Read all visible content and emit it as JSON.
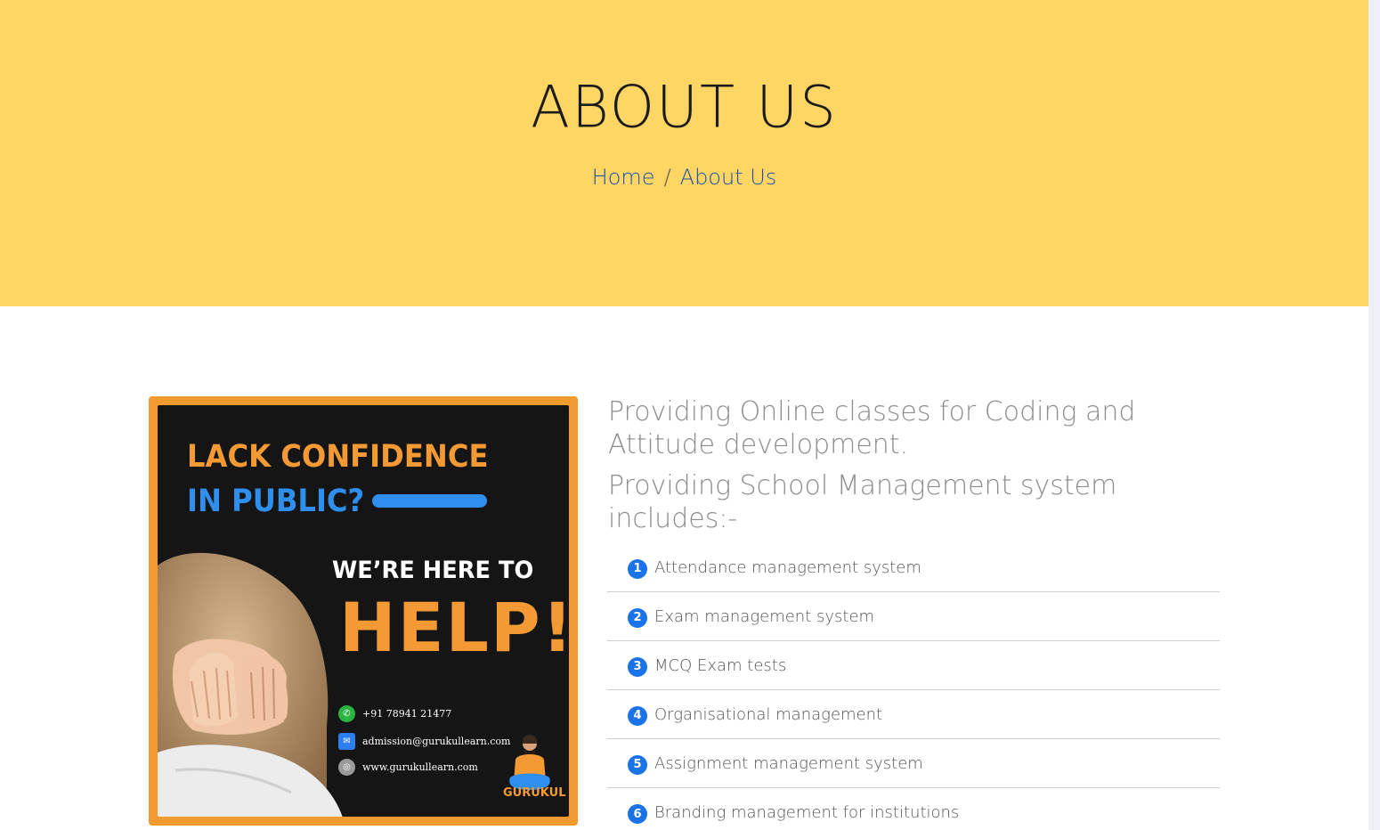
{
  "hero": {
    "title": "ABOUT US",
    "breadcrumb": {
      "home": "Home",
      "separator": "/",
      "current": "About Us"
    }
  },
  "poster": {
    "line1": "LACK CONFIDENCE",
    "line2": "IN PUBLIC?",
    "line3": "WE’RE HERE TO",
    "line4": "HELP!",
    "phone": "+91 78941 21477",
    "email": "admission@gurukullearn.com",
    "website": "www.gurukullearn.com",
    "logo_text": "GURUKUL",
    "icons": {
      "phone": "whatsapp-icon",
      "email": "mail-icon",
      "website": "globe-icon"
    },
    "colors": {
      "frame": "#f09a2f",
      "background": "#151515",
      "orange": "#f39a35",
      "blue": "#2f8fef"
    }
  },
  "content": {
    "intro_1": "Providing Online classes for Coding and Attitude development.",
    "intro_2": "Providing School Management system includes:-",
    "features": [
      {
        "num": "1",
        "label": " Attendance management system"
      },
      {
        "num": "2",
        "label": " Exam management system"
      },
      {
        "num": "3",
        "label": "MCQ Exam tests"
      },
      {
        "num": "4",
        "label": "Organisational management"
      },
      {
        "num": "5",
        "label": "Assignment management system"
      },
      {
        "num": "6",
        "label": " Branding management for institutions"
      }
    ]
  },
  "colors": {
    "hero_bg": "#ffd563",
    "accent_blue": "#1a73e8",
    "breadcrumb": "#1e4fae"
  }
}
